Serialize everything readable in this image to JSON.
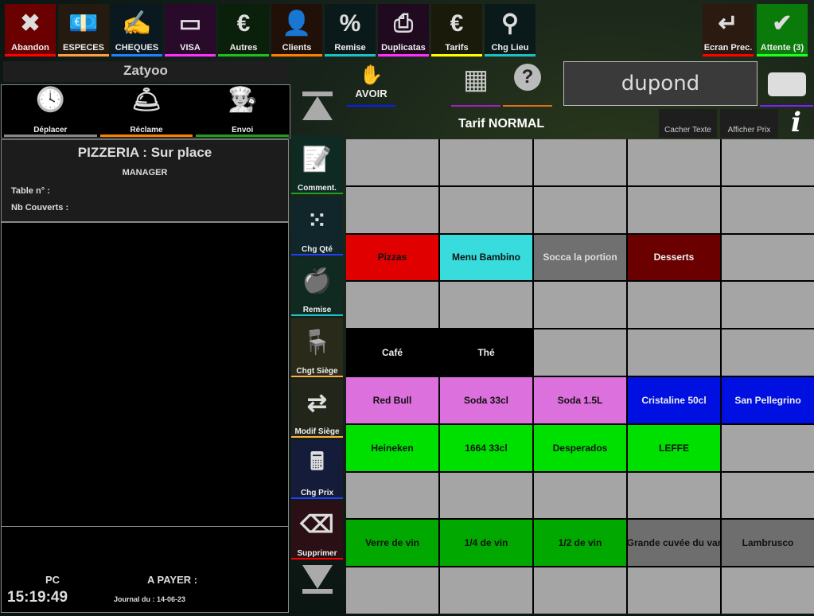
{
  "toolbar": [
    {
      "label": "Abandon",
      "icon": "close-icon",
      "glyph": "✖",
      "bg": "#6a0000",
      "line": "#ff0000"
    },
    {
      "label": "ESPECES",
      "icon": "cash-icon",
      "glyph": "💶",
      "bg": "#241a10",
      "line": "#ffa040"
    },
    {
      "label": "CHEQUES",
      "icon": "cheque-icon",
      "glyph": "✍",
      "bg": "#0a1820",
      "line": "#2080ff"
    },
    {
      "label": "VISA",
      "icon": "credit-card-icon",
      "glyph": "▭",
      "bg": "#2a0a2a",
      "line": "#ff30ff"
    },
    {
      "label": "Autres",
      "icon": "other-payment-icon",
      "glyph": "€",
      "bg": "#0a200a",
      "line": "#20c020"
    },
    {
      "label": "Clients",
      "icon": "client-card-icon",
      "glyph": "👤",
      "bg": "#201008",
      "line": "#ff8000"
    },
    {
      "label": "Remise",
      "icon": "discount-receipt-icon",
      "glyph": "%",
      "bg": "#0a1a1a",
      "line": "#20c0c0"
    },
    {
      "label": "Duplicatas",
      "icon": "printer-icon",
      "glyph": "⎙",
      "bg": "#200a20",
      "line": "#ff30ff"
    },
    {
      "label": "Tarifs",
      "icon": "price-tag-icon",
      "glyph": "€",
      "bg": "#1a1a0a",
      "line": "#ffff00"
    },
    {
      "label": "Chg Lieu",
      "icon": "location-pin-icon",
      "glyph": "⚲",
      "bg": "#0a1a1a",
      "line": "#20c0c0"
    }
  ],
  "right_toolbar": [
    {
      "label": "Ecran Prec.",
      "icon": "return-arrow-icon",
      "glyph": "↵",
      "bg": "#2a1a10",
      "line": "#ff0000"
    },
    {
      "label": "Attente (3)",
      "icon": "check-icon",
      "glyph": "✔",
      "bg": "#0a7a0a",
      "line": "#20ff20"
    }
  ],
  "header": {
    "title": "Zatyoo"
  },
  "actions": [
    {
      "label": "Déplacer",
      "icon": "clock-icon",
      "glyph": "🕓",
      "line": "#888888"
    },
    {
      "label": "Réclame",
      "icon": "service-bell-icon",
      "glyph": "🛎",
      "line": "#ff8000"
    },
    {
      "label": "Envoi",
      "icon": "chef-hat-icon",
      "glyph": "👨‍🍳",
      "line": "#20a020"
    }
  ],
  "order": {
    "title": "PIZZERIA : Sur place",
    "user": "MANAGER",
    "table_label": "Table n° :",
    "covers_label": "Nb Couverts :"
  },
  "footer": {
    "terminal": "PC",
    "time": "15:19:49",
    "to_pay_label": "A PAYER :",
    "journal": "Journal du : 14-06-23"
  },
  "sidebar": [
    {
      "label": "Comment.",
      "icon": "calendar-pencil-icon",
      "glyph": "📝",
      "line": "#20a020"
    },
    {
      "label": "Chg Qté",
      "icon": "abacus-icon",
      "glyph": "⁙",
      "line": "#2040ff"
    },
    {
      "label": "Remise",
      "icon": "apple-discount-icon",
      "glyph": "🍎",
      "line": "#20c0c0"
    },
    {
      "label": "Chgt Siège",
      "icon": "chair-icon",
      "glyph": "🪑",
      "line": "#ffb040"
    },
    {
      "label": "Modif Siège",
      "icon": "chair-swap-icon",
      "glyph": "⇄",
      "line": "#ffb040"
    },
    {
      "label": "Chg Prix",
      "icon": "calculator-icon",
      "glyph": "🖩",
      "line": "#2040ff"
    },
    {
      "label": "Supprimer",
      "icon": "eraser-icon",
      "glyph": "⌫",
      "line": "#ff0000"
    }
  ],
  "avoir": {
    "label": "AVOIR",
    "icon": "hand-money-icon"
  },
  "qr_icon": "qr-code-icon",
  "help_icon": "help-icon",
  "search": {
    "value": "dupond"
  },
  "tarif": "Tarif NORMAL",
  "hide_text": "Cacher Texte",
  "show_price": "Afficher Prix",
  "grid": [
    null,
    null,
    null,
    null,
    null,
    null,
    null,
    null,
    null,
    null,
    {
      "label": "Pizzas",
      "bg": "#e00000",
      "fg": "#111"
    },
    {
      "label": "Menu Bambino",
      "bg": "#38dcdc",
      "fg": "#111"
    },
    {
      "label": "Socca la portion",
      "bg": "#707070",
      "fg": "#ddd"
    },
    {
      "label": "Desserts",
      "bg": "#6a0000",
      "fg": "#eee"
    },
    null,
    null,
    null,
    null,
    null,
    null,
    {
      "label": "Café",
      "bg": "#000",
      "fg": "#eee"
    },
    {
      "label": "Thé",
      "bg": "#000",
      "fg": "#eee"
    },
    null,
    null,
    null,
    {
      "label": "Red Bull",
      "bg": "#dc70dc",
      "fg": "#111"
    },
    {
      "label": "Soda 33cl",
      "bg": "#dc70dc",
      "fg": "#111"
    },
    {
      "label": "Soda 1.5L",
      "bg": "#dc70dc",
      "fg": "#111"
    },
    {
      "label": "Cristaline 50cl",
      "bg": "#0010e0",
      "fg": "#eee"
    },
    {
      "label": "San Pellegrino",
      "bg": "#0010e0",
      "fg": "#eee"
    },
    {
      "label": "Heineken",
      "bg": "#00e000",
      "fg": "#111"
    },
    {
      "label": "1664 33cl",
      "bg": "#00e000",
      "fg": "#111"
    },
    {
      "label": "Desperados",
      "bg": "#00e000",
      "fg": "#111"
    },
    {
      "label": "LEFFE",
      "bg": "#00e000",
      "fg": "#111"
    },
    null,
    null,
    null,
    null,
    null,
    null,
    {
      "label": "Verre de vin",
      "bg": "#00a800",
      "fg": "#111"
    },
    {
      "label": "1/4 de vin",
      "bg": "#00a800",
      "fg": "#111"
    },
    {
      "label": "1/2 de vin",
      "bg": "#00a800",
      "fg": "#111"
    },
    {
      "label": "Grande cuvée du var",
      "bg": "#6e6e6e",
      "fg": "#111"
    },
    {
      "label": "Lambrusco",
      "bg": "#6e6e6e",
      "fg": "#111"
    },
    null,
    null,
    null,
    null,
    null
  ]
}
